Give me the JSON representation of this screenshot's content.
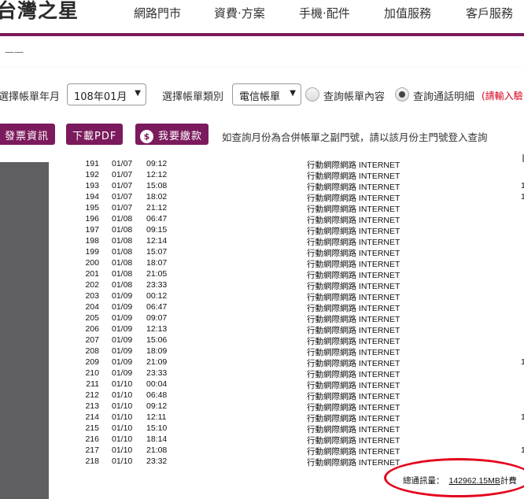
{
  "brand": {
    "logo_text": "台灣之星"
  },
  "nav": {
    "items": [
      "網路門市",
      "資費·方案",
      "手機·配件",
      "加值服務",
      "客戶服務"
    ]
  },
  "sub_header": {
    "label": "一一"
  },
  "filters": {
    "bill_month_label": "選擇帳單年月",
    "bill_month_value": "108年01月",
    "bill_type_label": "選擇帳單類別",
    "bill_type_value": "電信帳單",
    "radio_content_label": "查詢帳單內容",
    "radio_call_detail_label": "查詢通話明細",
    "red_note": "(請輸入驗"
  },
  "actions": {
    "invoice_button": "發票資訊",
    "pdf_button": "下載PDF",
    "pay_button": "我要繳款",
    "info_text": "如查詢月份為合併帳單之副門號，請以該月份主門號登入查詢"
  },
  "records": [
    {
      "no": "191",
      "date": "01/07",
      "time": "09:12",
      "type": "行動網際網路 INTERNET",
      "amt": ""
    },
    {
      "no": "192",
      "date": "01/07",
      "time": "12:12",
      "type": "行動網際網路 INTERNET",
      "amt": ""
    },
    {
      "no": "193",
      "date": "01/07",
      "time": "15:08",
      "type": "行動網際網路 INTERNET",
      "amt": "1"
    },
    {
      "no": "194",
      "date": "01/07",
      "time": "18:02",
      "type": "行動網際網路 INTERNET",
      "amt": "1"
    },
    {
      "no": "195",
      "date": "01/07",
      "time": "21:12",
      "type": "行動網際網路 INTERNET",
      "amt": ""
    },
    {
      "no": "196",
      "date": "01/08",
      "time": "06:47",
      "type": "行動網際網路 INTERNET",
      "amt": ""
    },
    {
      "no": "197",
      "date": "01/08",
      "time": "09:15",
      "type": "行動網際網路 INTERNET",
      "amt": ""
    },
    {
      "no": "198",
      "date": "01/08",
      "time": "12:14",
      "type": "行動網際網路 INTERNET",
      "amt": ""
    },
    {
      "no": "199",
      "date": "01/08",
      "time": "15:07",
      "type": "行動網際網路 INTERNET",
      "amt": ""
    },
    {
      "no": "200",
      "date": "01/08",
      "time": "18:07",
      "type": "行動網際網路 INTERNET",
      "amt": ""
    },
    {
      "no": "201",
      "date": "01/08",
      "time": "21:05",
      "type": "行動網際網路 INTERNET",
      "amt": ""
    },
    {
      "no": "202",
      "date": "01/08",
      "time": "23:33",
      "type": "行動網際網路 INTERNET",
      "amt": ""
    },
    {
      "no": "203",
      "date": "01/09",
      "time": "00:12",
      "type": "行動網際網路 INTERNET",
      "amt": ""
    },
    {
      "no": "204",
      "date": "01/09",
      "time": "06:47",
      "type": "行動網際網路 INTERNET",
      "amt": ""
    },
    {
      "no": "205",
      "date": "01/09",
      "time": "09:07",
      "type": "行動網際網路 INTERNET",
      "amt": ""
    },
    {
      "no": "206",
      "date": "01/09",
      "time": "12:13",
      "type": "行動網際網路 INTERNET",
      "amt": ""
    },
    {
      "no": "207",
      "date": "01/09",
      "time": "15:06",
      "type": "行動網際網路 INTERNET",
      "amt": ""
    },
    {
      "no": "208",
      "date": "01/09",
      "time": "18:09",
      "type": "行動網際網路 INTERNET",
      "amt": ""
    },
    {
      "no": "209",
      "date": "01/09",
      "time": "21:09",
      "type": "行動網際網路 INTERNET",
      "amt": "1"
    },
    {
      "no": "210",
      "date": "01/09",
      "time": "23:33",
      "type": "行動網際網路 INTERNET",
      "amt": ""
    },
    {
      "no": "211",
      "date": "01/10",
      "time": "00:04",
      "type": "行動網際網路 INTERNET",
      "amt": ""
    },
    {
      "no": "212",
      "date": "01/10",
      "time": "06:48",
      "type": "行動網際網路 INTERNET",
      "amt": ""
    },
    {
      "no": "213",
      "date": "01/10",
      "time": "09:12",
      "type": "行動網際網路 INTERNET",
      "amt": ""
    },
    {
      "no": "214",
      "date": "01/10",
      "time": "12:11",
      "type": "行動網際網路 INTERNET",
      "amt": "1"
    },
    {
      "no": "215",
      "date": "01/10",
      "time": "15:10",
      "type": "行動網際網路 INTERNET",
      "amt": ""
    },
    {
      "no": "216",
      "date": "01/10",
      "time": "18:14",
      "type": "行動網際網路 INTERNET",
      "amt": ""
    },
    {
      "no": "217",
      "date": "01/10",
      "time": "21:08",
      "type": "行動網際網路 INTERNET",
      "amt": "1"
    },
    {
      "no": "218",
      "date": "01/10",
      "time": "23:32",
      "type": "行動網際網路 INTERNET",
      "amt": ""
    }
  ],
  "summary": {
    "total_label": "總通訊量：",
    "total_value": "142962.15MB",
    "trailing_text": "計費"
  },
  "colors": {
    "brand_purple": "#7b1a5c",
    "highlight_red": "#e4001b",
    "note_red": "#d4001a"
  }
}
